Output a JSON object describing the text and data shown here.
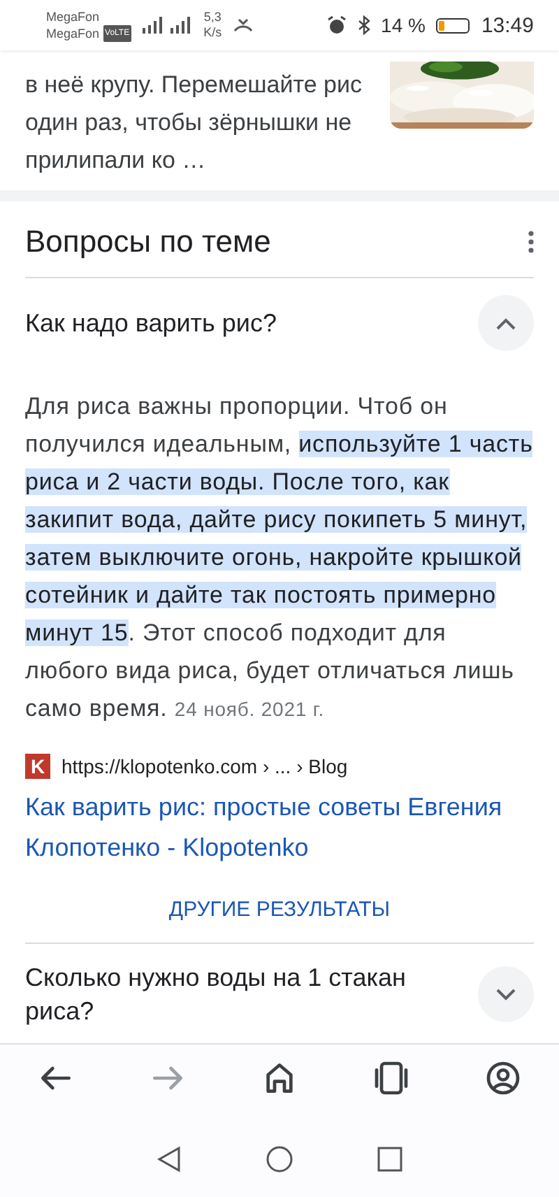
{
  "status_bar": {
    "carrier_1": "MegaFon",
    "carrier_2": "MegaFon",
    "volte": "VoLTE",
    "speed": "5,3",
    "speed_unit": "K/s",
    "battery": "14 %",
    "time": "13:49"
  },
  "snippet": {
    "text": "в неё крупу. Перемешайте рис один раз, чтобы зёрнышки не прилипали ко …"
  },
  "related_questions": {
    "title": "Вопросы по теме",
    "questions": [
      {
        "question": "Как надо варить рис?",
        "expanded": true,
        "answer": {
          "before": "Для риса важны пропорции. Чтоб он получился идеальным, ",
          "highlighted": "используйте 1 часть риса и 2 части воды. После того, как закипит вода, дайте рису покипеть 5 минут, затем выключите огонь, накройте крышкой сотейник и дайте так постоять примерно минут 15",
          "after": ". Этот способ подходит для любого вида риса, будет отличаться лишь само время.",
          "date": "24 нояб. 2021 г."
        },
        "source": {
          "favicon": "K",
          "url": "https://klopotenko.com › ... › Blog",
          "title": "Как варить рис: простые советы Евгения Клопотенко - Klopotenko"
        },
        "more": "ДРУГИЕ РЕЗУЛЬТАТЫ"
      },
      {
        "question": "Сколько нужно воды на 1 стакан риса?",
        "expanded": false
      }
    ]
  },
  "browser_toolbar": [
    {
      "kind": "back",
      "disabled": false
    },
    {
      "kind": "forward",
      "disabled": true
    },
    {
      "kind": "home",
      "disabled": false
    },
    {
      "kind": "tabs",
      "disabled": false
    },
    {
      "kind": "account",
      "disabled": false
    }
  ]
}
